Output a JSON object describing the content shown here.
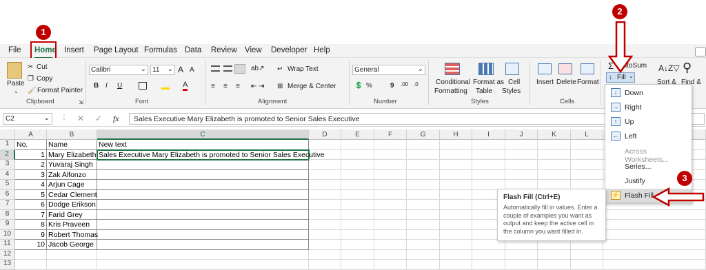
{
  "menu": {
    "file": "File",
    "home": "Home",
    "insert": "Insert",
    "page_layout": "Page Layout",
    "formulas": "Formulas",
    "data": "Data",
    "review": "Review",
    "view": "View",
    "developer": "Developer",
    "help": "Help"
  },
  "clipboard": {
    "paste": "Paste",
    "cut": "Cut",
    "copy": "Copy",
    "format_painter": "Format Painter",
    "group": "Clipboard"
  },
  "font": {
    "name": "Calibri",
    "size": "11",
    "bold": "B",
    "italic": "I",
    "underline": "U",
    "grow": "A",
    "shrink": "A",
    "color_letter": "A",
    "group": "Font"
  },
  "alignment": {
    "wrap_text": "Wrap Text",
    "merge": "Merge & Center",
    "group": "Alignment"
  },
  "number": {
    "format": "General",
    "percent": "%",
    "comma": "9",
    "group": "Number"
  },
  "styles": {
    "conditional": "Conditional",
    "formatting": "Formatting",
    "format_as": "Format as",
    "table": "Table",
    "cell": "Cell",
    "styles": "Styles",
    "group": "Styles"
  },
  "cells": {
    "insert": "Insert",
    "delete": "Delete",
    "format": "Format",
    "group": "Cells"
  },
  "editing": {
    "autosum": "AutoSum",
    "fill": "Fill",
    "sort": "Sort &",
    "find": "Find &"
  },
  "formula_bar": {
    "name_box": "C2",
    "fx": "fx",
    "content": "Sales Executive Mary Elizabeth is promoted to Senior Sales Executive"
  },
  "columns": [
    "A",
    "B",
    "C",
    "D",
    "E",
    "F",
    "G",
    "H",
    "I",
    "J",
    "K",
    "L"
  ],
  "rows": [
    "1",
    "2",
    "3",
    "4",
    "5",
    "6",
    "7",
    "8",
    "9",
    "10",
    "11",
    "12",
    "13"
  ],
  "headers": {
    "a": "No.",
    "b": "Name",
    "c": "New text"
  },
  "data_rows": [
    {
      "no": "1",
      "name": "Mary Elizabeth",
      "text": "Sales Executive Mary Elizabeth is promoted to Senior Sales Executive"
    },
    {
      "no": "2",
      "name": "Yuvaraj Singh",
      "text": ""
    },
    {
      "no": "3",
      "name": "Zak Alfonzo",
      "text": ""
    },
    {
      "no": "4",
      "name": "Arjun Cage",
      "text": ""
    },
    {
      "no": "5",
      "name": "Cedar Clement",
      "text": ""
    },
    {
      "no": "6",
      "name": "Dodge Erikson",
      "text": ""
    },
    {
      "no": "7",
      "name": "Farid Grey",
      "text": ""
    },
    {
      "no": "8",
      "name": "Kris Praveen",
      "text": ""
    },
    {
      "no": "9",
      "name": "Robert Thomas",
      "text": ""
    },
    {
      "no": "10",
      "name": "Jacob George",
      "text": ""
    }
  ],
  "fill_menu": {
    "down": "Down",
    "right": "Right",
    "up": "Up",
    "left": "Left",
    "across": "Across Worksheets...",
    "series": "Series...",
    "justify": "Justify",
    "flash": "Flash Fill"
  },
  "tooltip": {
    "title": "Flash Fill (Ctrl+E)",
    "body": "Automatically fill in values. Enter a couple of examples you want as output and keep the active cell in the column you want filled in."
  },
  "badges": [
    "1",
    "2",
    "3"
  ],
  "colors": {
    "accent_green": "#217346",
    "annotation_red": "#c00000"
  }
}
